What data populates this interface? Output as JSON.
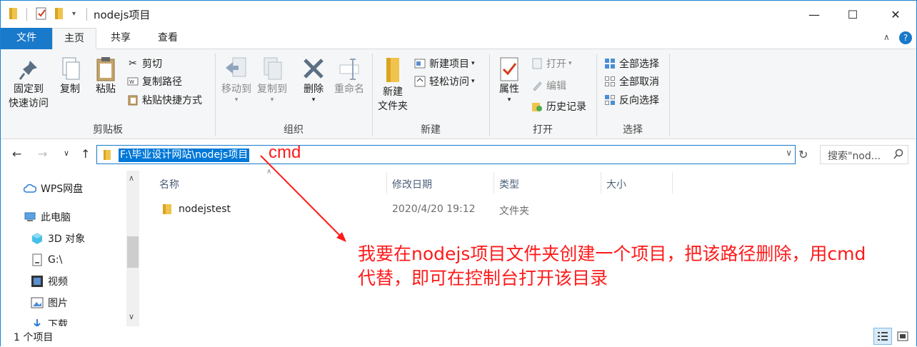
{
  "window": {
    "title": "nodejs项目",
    "controls": {
      "minimize": "—",
      "maximize": "☐",
      "close": "✕"
    }
  },
  "ribbon_tabs": [
    "文件",
    "主页",
    "共享",
    "查看"
  ],
  "ribbon": {
    "clipboard": {
      "label": "剪贴板",
      "pin": [
        "固定到",
        "快速访问"
      ],
      "copy": "复制",
      "paste": "粘贴",
      "cut": "剪切",
      "copy_path": "复制路径",
      "paste_shortcut": "粘贴快捷方式"
    },
    "organize": {
      "label": "组织",
      "move_to": "移动到",
      "copy_to": "复制到",
      "delete": "删除",
      "rename": "重命名"
    },
    "new": {
      "label": "新建",
      "new_folder": [
        "新建",
        "文件夹"
      ],
      "new_item": "新建项目",
      "easy_access": "轻松访问"
    },
    "open": {
      "label": "打开",
      "properties": "属性",
      "open": "打开",
      "edit": "编辑",
      "history": "历史记录"
    },
    "select": {
      "label": "选择",
      "select_all": "全部选择",
      "select_none": "全部取消",
      "invert": "反向选择"
    }
  },
  "address_bar": {
    "path": "F:\\毕业设计网站\\nodejs项目"
  },
  "search": {
    "placeholder": "搜索\"nod..."
  },
  "nav_pane": {
    "items": [
      {
        "label": "WPS网盘",
        "icon": "cloud-icon"
      },
      {
        "label": "此电脑",
        "icon": "computer-icon"
      },
      {
        "label": "3D 对象",
        "icon": "cube-icon"
      },
      {
        "label": "G:\\",
        "icon": "drive-icon"
      },
      {
        "label": "视频",
        "icon": "video-icon"
      },
      {
        "label": "图片",
        "icon": "picture-icon"
      },
      {
        "label": "下载",
        "icon": "download-icon"
      }
    ]
  },
  "file_list": {
    "columns": [
      "名称",
      "修改日期",
      "类型",
      "大小"
    ],
    "rows": [
      {
        "name": "nodejstest",
        "modified": "2020/4/20 19:12",
        "type": "文件夹",
        "size": ""
      }
    ]
  },
  "status_bar": {
    "count": "1 个项目"
  },
  "annotations": {
    "cmd": "cmd",
    "note_line1": "我要在nodejs项目文件夹创建一个项目，把该路径删除，用cmd",
    "note_line2": "代替，即可在控制台打开该目录"
  },
  "colors": {
    "accent": "#1979ca",
    "selection": "#0078d7",
    "annotation": "#ff1a1a",
    "folder": "#f8d775"
  }
}
